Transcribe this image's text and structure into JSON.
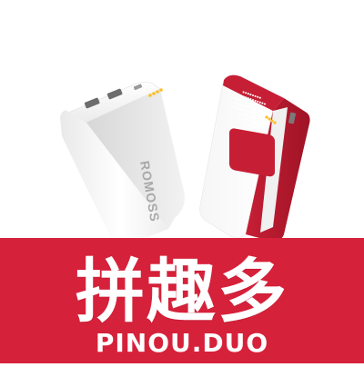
{
  "product": {
    "brand_text": "ROMOSS",
    "colors": {
      "body": "#f4f4f4",
      "shadow": "#d9d9d9",
      "accent": "#b3192f",
      "port": "#ffbd2a"
    },
    "icons": [
      "power-bank-left",
      "power-bank-right",
      "grille-icon"
    ]
  },
  "banner": {
    "title": "拼趣多",
    "subtitle": "PINOU.DUO",
    "background": "#d6213a",
    "text_color": "#ffffff"
  }
}
